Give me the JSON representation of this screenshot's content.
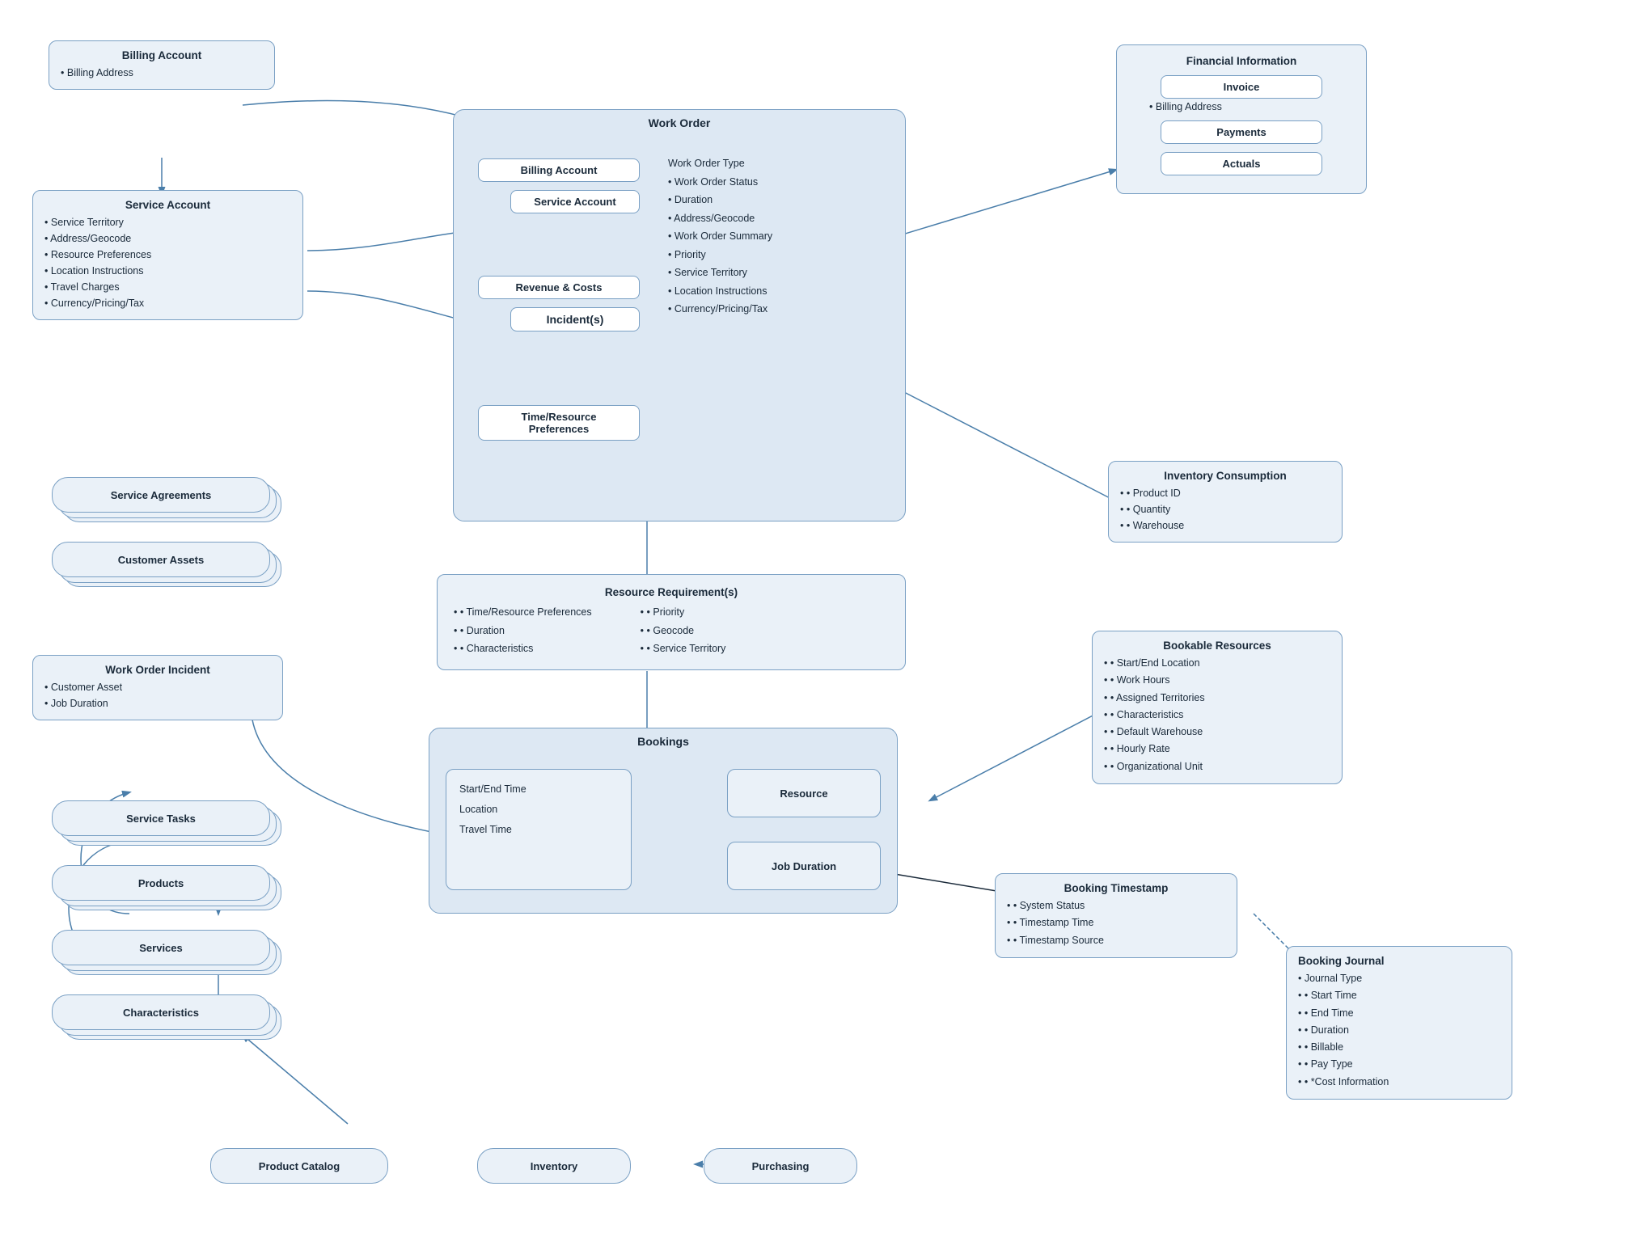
{
  "billing_account_top": {
    "title": "Billing Account",
    "items": [
      "Billing Address"
    ]
  },
  "service_account": {
    "title": "Service Account",
    "items": [
      "Service Territory",
      "Address/Geocode",
      "Resource Preferences",
      "Location Instructions",
      "Travel Charges",
      "Currency/Pricing/Tax"
    ]
  },
  "service_agreements": {
    "label": "Service Agreements"
  },
  "customer_assets": {
    "label": "Customer Assets"
  },
  "work_order_incident": {
    "title": "Work Order Incident",
    "items": [
      "Customer Asset",
      "Job Duration"
    ]
  },
  "service_tasks": {
    "label": "Service Tasks"
  },
  "products": {
    "label": "Products"
  },
  "services": {
    "label": "Services"
  },
  "characteristics": {
    "label": "Characteristics"
  },
  "product_catalog": {
    "label": "Product Catalog"
  },
  "inventory": {
    "label": "Inventory"
  },
  "purchasing": {
    "label": "Purchasing"
  },
  "work_order": {
    "title": "Work Order",
    "billing_account": "Billing Account",
    "service_account": "Service Account",
    "revenue_costs": "Revenue & Costs",
    "incidents": "Incident(s)",
    "time_resource": "Time/Resource Preferences",
    "items": [
      "Work Order Type",
      "Work Order Status",
      "Duration",
      "Address/Geocode",
      "Work Order Summary",
      "Priority",
      "Service Territory",
      "Location Instructions",
      "Currency/Pricing/Tax"
    ]
  },
  "financial_information": {
    "title": "Financial Information",
    "invoice": "Invoice",
    "invoice_item": "Billing Address",
    "payments": "Payments",
    "actuals": "Actuals"
  },
  "inventory_consumption": {
    "title": "Inventory Consumption",
    "items": [
      "Product ID",
      "Quantity",
      "Warehouse"
    ]
  },
  "resource_requirements": {
    "title": "Resource Requirement(s)",
    "col1": [
      "Time/Resource Preferences",
      "Duration",
      "Characteristics"
    ],
    "col2": [
      "Priority",
      "Geocode",
      "Service Territory"
    ]
  },
  "bookings": {
    "title": "Bookings",
    "left": [
      "Start/End Time",
      "Location",
      "Travel Time"
    ],
    "resource": "Resource",
    "job_duration": "Job Duration"
  },
  "bookable_resources": {
    "title": "Bookable Resources",
    "items": [
      "Start/End Location",
      "Work Hours",
      "Assigned Territories",
      "Characteristics",
      "Default Warehouse",
      "Hourly Rate",
      "Organizational Unit"
    ]
  },
  "booking_timestamp": {
    "title": "Booking Timestamp",
    "items": [
      "System Status",
      "Timestamp Time",
      "Timestamp Source"
    ]
  },
  "booking_journal": {
    "title": "Booking Journal",
    "items": [
      "Journal Type",
      "Start Time",
      "End Time",
      "Duration",
      "Billable",
      "Pay Type",
      "*Cost Information"
    ]
  }
}
